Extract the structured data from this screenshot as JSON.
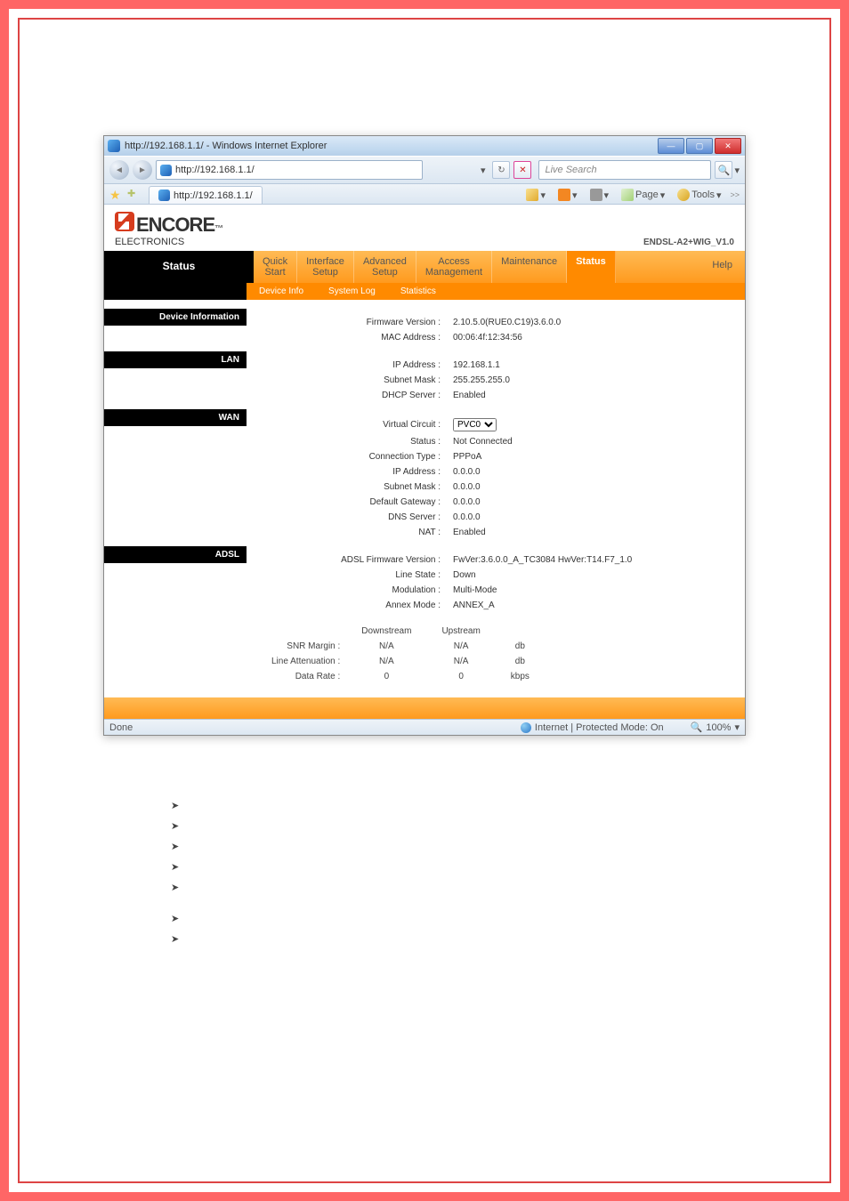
{
  "window": {
    "title": "http://192.168.1.1/ - Windows Internet Explorer",
    "min": "—",
    "max": "▢",
    "close": "✕"
  },
  "nav": {
    "url": "http://192.168.1.1/",
    "refresh": "↻",
    "closex": "✕",
    "live_search": "Live Search",
    "search_icon": "🔍"
  },
  "tabbar": {
    "tab_label": "http://192.168.1.1/",
    "page": "Page",
    "tools": "Tools",
    "chevrons": ">>"
  },
  "header": {
    "brand_main": "ENCORE",
    "brand_sub": "ELECTRONICS",
    "model": "ENDSL-A2+WIG_V1.0"
  },
  "mainnav": {
    "side": "Status",
    "items": [
      {
        "line1": "Quick",
        "line2": "Start"
      },
      {
        "line1": "Interface",
        "line2": "Setup"
      },
      {
        "line1": "Advanced",
        "line2": "Setup"
      },
      {
        "line1": "Access",
        "line2": "Management"
      },
      {
        "line1": "Maintenance",
        "line2": ""
      }
    ],
    "active": "Status",
    "help": "Help"
  },
  "subnav": [
    "Device Info",
    "System Log",
    "Statistics"
  ],
  "sections": {
    "devinfo": {
      "title": "Device Information",
      "rows": [
        {
          "label": "Firmware Version :",
          "value": "2.10.5.0(RUE0.C19)3.6.0.0"
        },
        {
          "label": "MAC Address :",
          "value": "00:06:4f:12:34:56"
        }
      ]
    },
    "lan": {
      "title": "LAN",
      "rows": [
        {
          "label": "IP Address :",
          "value": "192.168.1.1"
        },
        {
          "label": "Subnet Mask :",
          "value": "255.255.255.0"
        },
        {
          "label": "DHCP Server :",
          "value": "Enabled"
        }
      ]
    },
    "wan": {
      "title": "WAN",
      "circuit_label": "Virtual Circuit :",
      "circuit_value": "PVC0",
      "rows": [
        {
          "label": "Status :",
          "value": "Not Connected"
        },
        {
          "label": "Connection Type :",
          "value": "PPPoA"
        },
        {
          "label": "IP Address :",
          "value": "0.0.0.0"
        },
        {
          "label": "Subnet Mask :",
          "value": "0.0.0.0"
        },
        {
          "label": "Default Gateway :",
          "value": "0.0.0.0"
        },
        {
          "label": "DNS Server :",
          "value": "0.0.0.0"
        },
        {
          "label": "NAT :",
          "value": "Enabled"
        }
      ]
    },
    "adsl": {
      "title": "ADSL",
      "rows": [
        {
          "label": "ADSL Firmware Version :",
          "value": "FwVer:3.6.0.0_A_TC3084 HwVer:T14.F7_1.0"
        },
        {
          "label": "Line State :",
          "value": "Down"
        },
        {
          "label": "Modulation :",
          "value": "Multi-Mode"
        },
        {
          "label": "Annex Mode :",
          "value": "ANNEX_A"
        }
      ],
      "stats": {
        "cols": [
          "Downstream",
          "Upstream",
          ""
        ],
        "rows": [
          {
            "label": "SNR Margin :",
            "down": "N/A",
            "up": "N/A",
            "unit": "db"
          },
          {
            "label": "Line Attenuation :",
            "down": "N/A",
            "up": "N/A",
            "unit": "db"
          },
          {
            "label": "Data Rate :",
            "down": "0",
            "up": "0",
            "unit": "kbps"
          }
        ]
      }
    }
  },
  "statusbar": {
    "done": "Done",
    "zone": "Internet | Protected Mode: On",
    "zoom": "100%"
  }
}
